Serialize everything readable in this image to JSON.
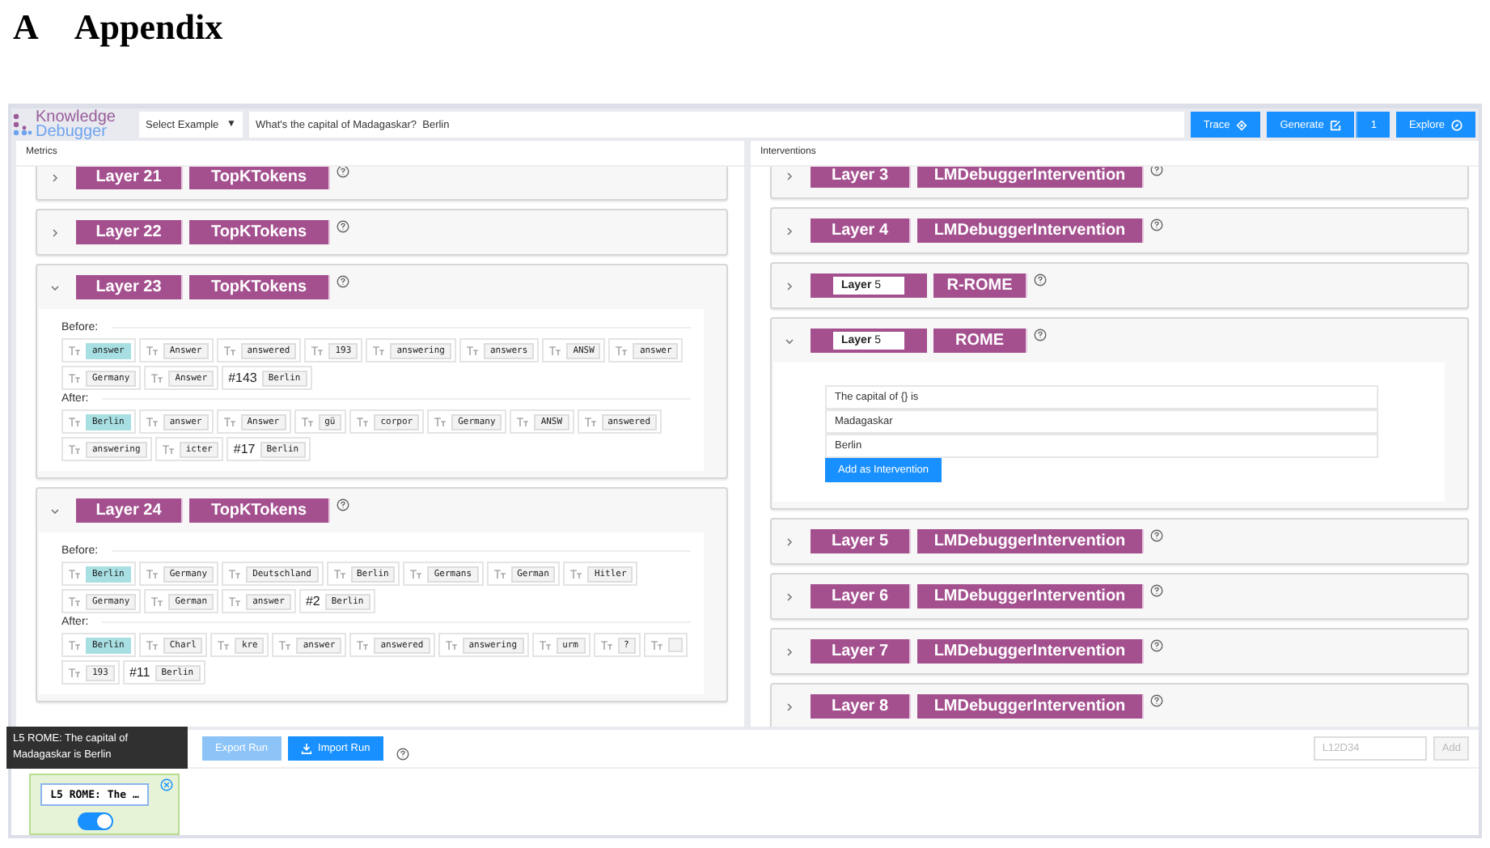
{
  "heading": {
    "number": "A",
    "title": "Appendix"
  },
  "top_bar": {
    "logo": [
      "Knowledge",
      "Debugger"
    ],
    "example_select": "Select Example",
    "select_caret": "▼",
    "prompt": "What's the capital of Madagaskar?  Berlin",
    "buttons": [
      {
        "kind": "button",
        "label": "Trace"
      },
      {
        "kind": "button",
        "label": "Generate"
      },
      {
        "kind": "count",
        "label": "1"
      },
      {
        "kind": "button",
        "label": "Explore"
      }
    ]
  },
  "metrics": {
    "title": "Metrics",
    "layers": [
      {
        "layer": "Layer 21",
        "type": "TopKTokens",
        "expanded": false
      },
      {
        "layer": "Layer 22",
        "type": "TopKTokens",
        "expanded": false
      },
      {
        "layer": "Layer 23",
        "type": "TopKTokens",
        "expanded": true,
        "before_label": "Before:",
        "after_label": "After:",
        "before": [
          {
            "kind": "token",
            "text": "answer",
            "highlighted": true
          },
          {
            "kind": "token",
            "text": "Answer",
            "highlighted": false
          },
          {
            "kind": "token",
            "text": "answered",
            "highlighted": false
          },
          {
            "kind": "token",
            "text": "193",
            "highlighted": false
          },
          {
            "kind": "token",
            "text": "answering",
            "highlighted": false
          },
          {
            "kind": "token",
            "text": "answers",
            "highlighted": false
          },
          {
            "kind": "token",
            "text": "ANSW",
            "highlighted": false
          },
          {
            "kind": "token",
            "text": "answer",
            "highlighted": false
          },
          {
            "kind": "token",
            "text": "Germany",
            "highlighted": false
          },
          {
            "kind": "token",
            "text": "Answer",
            "highlighted": false
          },
          {
            "kind": "rank",
            "rank": "#143",
            "text": "Berlin"
          }
        ],
        "after": [
          {
            "kind": "token",
            "text": "Berlin",
            "highlighted": true
          },
          {
            "kind": "token",
            "text": "answer",
            "highlighted": false
          },
          {
            "kind": "token",
            "text": "Answer",
            "highlighted": false
          },
          {
            "kind": "token",
            "text": "gü",
            "highlighted": false
          },
          {
            "kind": "token",
            "text": "corpor",
            "highlighted": false
          },
          {
            "kind": "token",
            "text": "Germany",
            "highlighted": false
          },
          {
            "kind": "token",
            "text": "ANSW",
            "highlighted": false
          },
          {
            "kind": "token",
            "text": "answered",
            "highlighted": false
          },
          {
            "kind": "token",
            "text": "answering",
            "highlighted": false
          },
          {
            "kind": "token",
            "text": "icter",
            "highlighted": false
          },
          {
            "kind": "rank",
            "rank": "#17",
            "text": "Berlin"
          }
        ]
      },
      {
        "layer": "Layer 24",
        "type": "TopKTokens",
        "expanded": true,
        "before_label": "Before:",
        "after_label": "After:",
        "before": [
          {
            "kind": "token",
            "text": "Berlin",
            "highlighted": true
          },
          {
            "kind": "token",
            "text": "Germany",
            "highlighted": false
          },
          {
            "kind": "token",
            "text": "Deutschland",
            "highlighted": false
          },
          {
            "kind": "token",
            "text": "Berlin",
            "highlighted": false
          },
          {
            "kind": "token",
            "text": "Germans",
            "highlighted": false
          },
          {
            "kind": "token",
            "text": "German",
            "highlighted": false
          },
          {
            "kind": "token",
            "text": "Hitler",
            "highlighted": false
          },
          {
            "kind": "token",
            "text": "Germany",
            "highlighted": false
          },
          {
            "kind": "token",
            "text": "German",
            "highlighted": false
          },
          {
            "kind": "token",
            "text": "answer",
            "highlighted": false
          },
          {
            "kind": "rank",
            "rank": "#2",
            "text": "Berlin"
          }
        ],
        "after": [
          {
            "kind": "token",
            "text": "Berlin",
            "highlighted": true
          },
          {
            "kind": "token",
            "text": "Charl",
            "highlighted": false
          },
          {
            "kind": "token",
            "text": "kre",
            "highlighted": false
          },
          {
            "kind": "token",
            "text": "answer",
            "highlighted": false
          },
          {
            "kind": "token",
            "text": "answered",
            "highlighted": false
          },
          {
            "kind": "token",
            "text": "answering",
            "highlighted": false
          },
          {
            "kind": "token",
            "text": "urm",
            "highlighted": false
          },
          {
            "kind": "token",
            "text": "?",
            "highlighted": false
          },
          {
            "kind": "blank"
          },
          {
            "kind": "token",
            "text": "193",
            "highlighted": false
          },
          {
            "kind": "rank",
            "rank": "#11",
            "text": "Berlin"
          }
        ]
      }
    ]
  },
  "interventions": {
    "title": "Interventions",
    "layers": [
      {
        "kind": "label",
        "layer": "Layer 3",
        "type": "LMDebuggerIntervention",
        "expanded": false
      },
      {
        "kind": "label",
        "layer": "Layer 4",
        "type": "LMDebuggerIntervention",
        "expanded": false
      },
      {
        "kind": "field",
        "layer": "**Layer** 5",
        "type": "R-ROME",
        "expanded": false
      },
      {
        "kind": "field",
        "layer": "**Layer** 5",
        "type": "ROME",
        "expanded": true,
        "fields": [
          "The capital of {} is",
          "Madagaskar",
          "Berlin"
        ],
        "button": "Add as Intervention"
      },
      {
        "kind": "label",
        "layer": "Layer 5",
        "type": "LMDebuggerIntervention",
        "expanded": false
      },
      {
        "kind": "label",
        "layer": "Layer 6",
        "type": "LMDebuggerIntervention",
        "expanded": false
      },
      {
        "kind": "label",
        "layer": "Layer 7",
        "type": "LMDebuggerIntervention",
        "expanded": false
      },
      {
        "kind": "label",
        "layer": "Layer 8",
        "type": "LMDebuggerIntervention",
        "expanded": false
      }
    ]
  },
  "bottom": {
    "export_button": "Export Run",
    "import_button": "Import Run",
    "code_placeholder": "L12D34",
    "add_button": "Add",
    "add_disabled": true,
    "applied": [
      {
        "label": "L5 ROME: The …",
        "on": true
      }
    ],
    "tooltip": "L5 ROME: The capital of Madagaskar is Berlin"
  }
}
